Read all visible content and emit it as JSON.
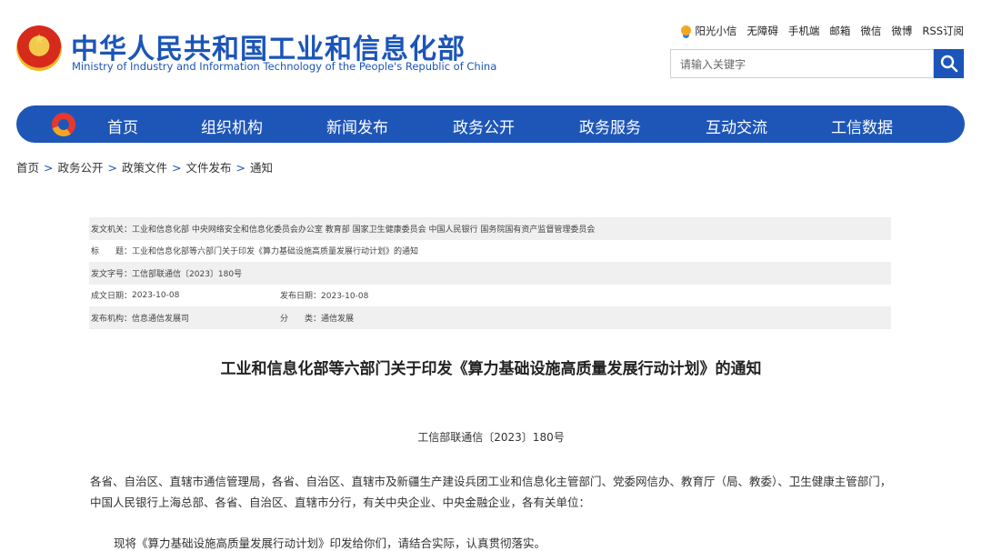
{
  "header": {
    "site_title": "中华人民共和国工业和信息化部",
    "site_subtitle": "Ministry of Industry and Information Technology of the People's Republic of China",
    "top_links": [
      "阳光小信",
      "无障碍",
      "手机端",
      "邮箱",
      "微信",
      "微博",
      "RSS订阅"
    ],
    "search_placeholder": "请输入关键字"
  },
  "nav": {
    "items": [
      "首页",
      "组织机构",
      "新闻发布",
      "政务公开",
      "政务服务",
      "互动交流",
      "工信数据"
    ]
  },
  "breadcrumb": [
    "首页",
    "政务公开",
    "政策文件",
    "文件发布",
    "通知"
  ],
  "breadcrumb_sep": ">",
  "info": {
    "issuer_label": "发文机关：",
    "issuer": "工业和信息化部 中央网络安全和信息化委员会办公室 教育部 国家卫生健康委员会 中国人民银行 国务院国有资产监督管理委员会",
    "title_label": "标　　题：",
    "title": "工业和信息化部等六部门关于印发《算力基础设施高质量发展行动计划》的通知",
    "docno_label": "发文字号：",
    "docno": "工信部联通信〔2023〕180号",
    "created_label": "成文日期：",
    "created": "2023-10-08",
    "published_label": "发布日期：",
    "published": "2023-10-08",
    "org_label": "发布机构：",
    "org": "信息通信发展司",
    "category_label": "分　　类：",
    "category": "通信发展"
  },
  "doc": {
    "title": "工业和信息化部等六部门关于印发《算力基础设施高质量发展行动计划》的通知",
    "number": "工信部联通信〔2023〕180号",
    "recipients": "各省、自治区、直辖市通信管理局，各省、自治区、直辖市及新疆生产建设兵团工业和信息化主管部门、党委网信办、教育厅（局、教委）、卫生健康主管部门，中国人民银行上海总部、各省、自治区、直辖市分行，有关中央企业、中央金融企业，各有关单位：",
    "body": "现将《算力基础设施高质量发展行动计划》印发给你们，请结合实际，认真贯彻落实。"
  },
  "colors": {
    "brand": "#1b55b9",
    "nav_bg": "#1e56b8",
    "row_shade": "#f0f0f0"
  }
}
